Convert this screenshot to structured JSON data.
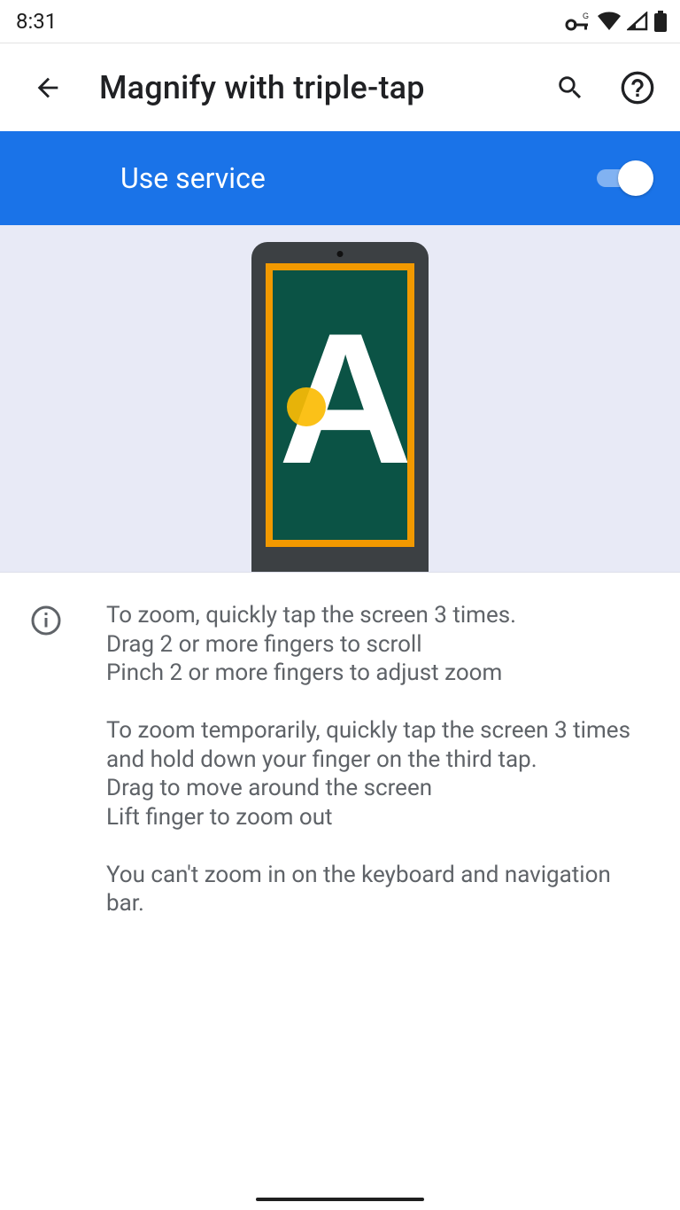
{
  "status": {
    "time": "8:31"
  },
  "header": {
    "title": "Magnify with triple-tap"
  },
  "service": {
    "label": "Use service",
    "enabled": true
  },
  "illustration": {
    "letter": "A"
  },
  "instructions": {
    "body": "To zoom, quickly tap the screen 3 times.\nDrag 2 or more fingers to scroll\nPinch 2 or more fingers to adjust zoom\n\nTo zoom temporarily, quickly tap the screen 3 times and hold down your finger on the third tap.\nDrag to move around the screen\nLift finger to zoom out\n\nYou can't zoom in on the keyboard and navigation bar."
  }
}
